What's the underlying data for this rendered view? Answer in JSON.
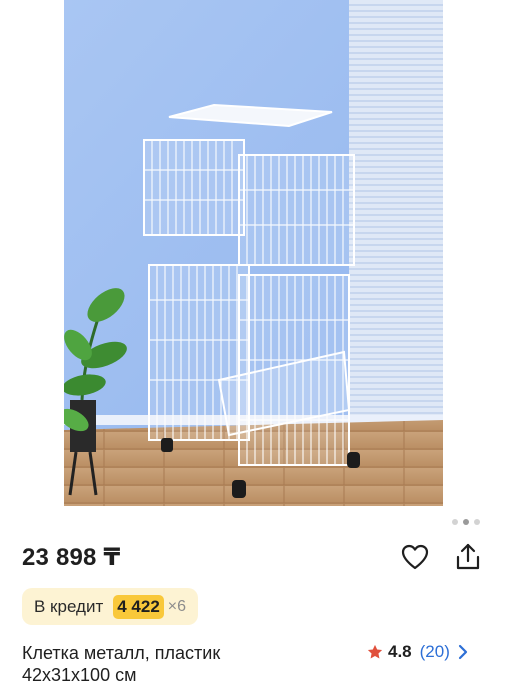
{
  "product": {
    "price": "23 898 ₸",
    "credit": {
      "label": "В кредит",
      "amount": "4 422",
      "multiplier": "×6"
    },
    "title_line1": "Клетка металл, пластик",
    "title_line2": "42x31x100 см",
    "rating": {
      "value": "4.8",
      "count": "(20)"
    }
  },
  "gallery": {
    "dots_total": 3,
    "active_dot": 2
  },
  "icons": {
    "favorite": "heart-icon",
    "share": "share-icon",
    "rating_star": "star-icon",
    "chevron": "chevron-right-icon"
  },
  "colors": {
    "credit_chip_bg": "#fdf3d3",
    "credit_amount_bg": "#f9c83a",
    "star": "#e0503c",
    "link": "#2d6fd6"
  }
}
